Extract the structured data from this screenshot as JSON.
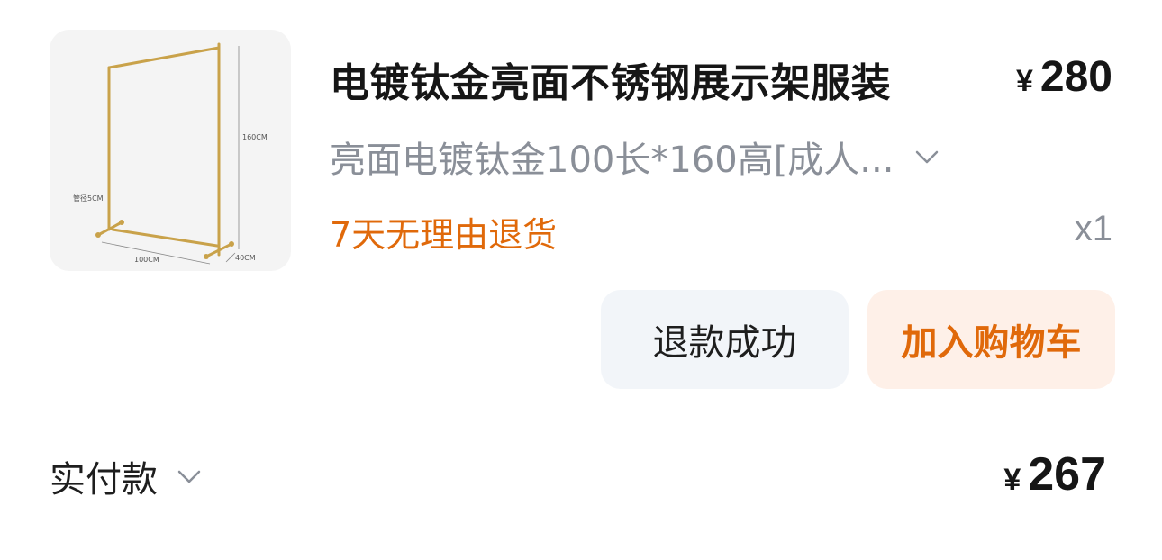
{
  "product": {
    "image_alt": "gold stainless steel clothing display rack",
    "image_labels": {
      "height": "160CM",
      "pipe": "管径5CM",
      "width": "100CM",
      "depth": "40CM"
    },
    "title": "电镀钛金亮面不锈钢展示架服装",
    "price": {
      "currency": "¥",
      "amount": "280"
    },
    "sku": "亮面电镀钛金100长*160高[成人...",
    "return_policy": "7天无理由退货",
    "quantity": "x1"
  },
  "actions": {
    "refund_label": "退款成功",
    "cart_label": "加入购物车"
  },
  "payment": {
    "label": "实付款",
    "currency": "¥",
    "amount": "267"
  },
  "colors": {
    "accent_orange": "#e0690a",
    "cart_button_bg": "#fef0e8",
    "refund_button_bg": "#f2f5f9",
    "muted_text": "#8a8f98",
    "rack_gold": "#c9a24a"
  },
  "icons": {
    "sku_expand": "chevron-down-icon",
    "payment_expand": "chevron-down-icon"
  }
}
